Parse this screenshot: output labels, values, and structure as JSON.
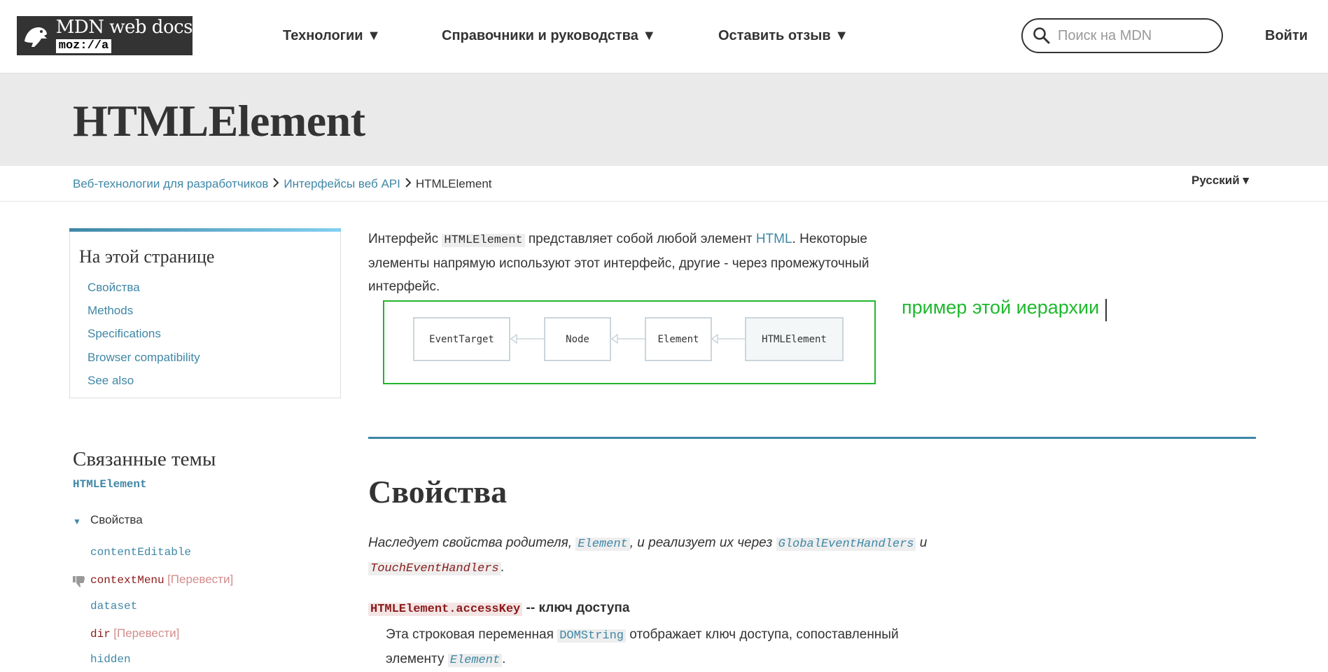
{
  "header": {
    "logo_title": "MDN web docs",
    "logo_sub": "moz://a",
    "nav": [
      {
        "label": "Технологии ▼"
      },
      {
        "label": "Справочники и руководства ▼"
      },
      {
        "label": "Оставить отзыв ▼"
      }
    ],
    "search_placeholder": "Поиск на MDN",
    "login_label": "Войти"
  },
  "page": {
    "title": "HTMLElement",
    "language": "Русский ▾",
    "breadcrumbs": [
      {
        "label": "Веб-технологии для разработчиков"
      },
      {
        "label": "Интерфейсы веб API"
      },
      {
        "label": "HTMLElement"
      }
    ]
  },
  "toc": {
    "title": "На этой странице",
    "items": [
      {
        "label": "Свойства"
      },
      {
        "label": "Methods"
      },
      {
        "label": "Specifications"
      },
      {
        "label": "Browser compatibility"
      },
      {
        "label": "See also"
      }
    ]
  },
  "related": {
    "title": "Связанные темы",
    "subtitle": "HTMLElement",
    "section": "Свойства",
    "translate_tag": "[Перевести]",
    "items": [
      {
        "label": "contentEditable"
      },
      {
        "label": "contextMenu"
      },
      {
        "label": "dataset"
      },
      {
        "label": "dir"
      },
      {
        "label": "hidden"
      }
    ]
  },
  "intro": {
    "part1": "Интерфейс ",
    "code": "HTMLElement",
    "part2": " представляет собой любой элемент ",
    "link": "HTML",
    "part3": ". Некоторые элементы напрямую используют этот интерфейс, другие - через промежуточный интерфейс."
  },
  "diagram": {
    "nodes": [
      {
        "label": "EventTarget"
      },
      {
        "label": "Node"
      },
      {
        "label": "Element"
      },
      {
        "label": "HTMLElement"
      }
    ]
  },
  "annotation": "пример этой иерархии",
  "section": {
    "heading": "Свойства",
    "inherit_1": "Наследует свойства родителя, ",
    "inherit_code1": "Element",
    "inherit_2": ", и реализует их через ",
    "inherit_code2": "GlobalEventHandlers",
    "inherit_3": " и ",
    "inherit_code3": "TouchEventHandlers",
    "inherit_4": ".",
    "prop_code": "HTMLElement.accessKey",
    "prop_text": " -- ключ доступа",
    "desc_1": "Эта строковая переменная ",
    "desc_code1": "DOMString",
    "desc_2": " отображает ключ доступа, сопоставленный элементу ",
    "desc_code2": "Element",
    "desc_3": "."
  },
  "colors": {
    "link": "#3f87a6",
    "annotation_green": "#1fb82e",
    "untranslated_red": "#8b1a1a"
  }
}
